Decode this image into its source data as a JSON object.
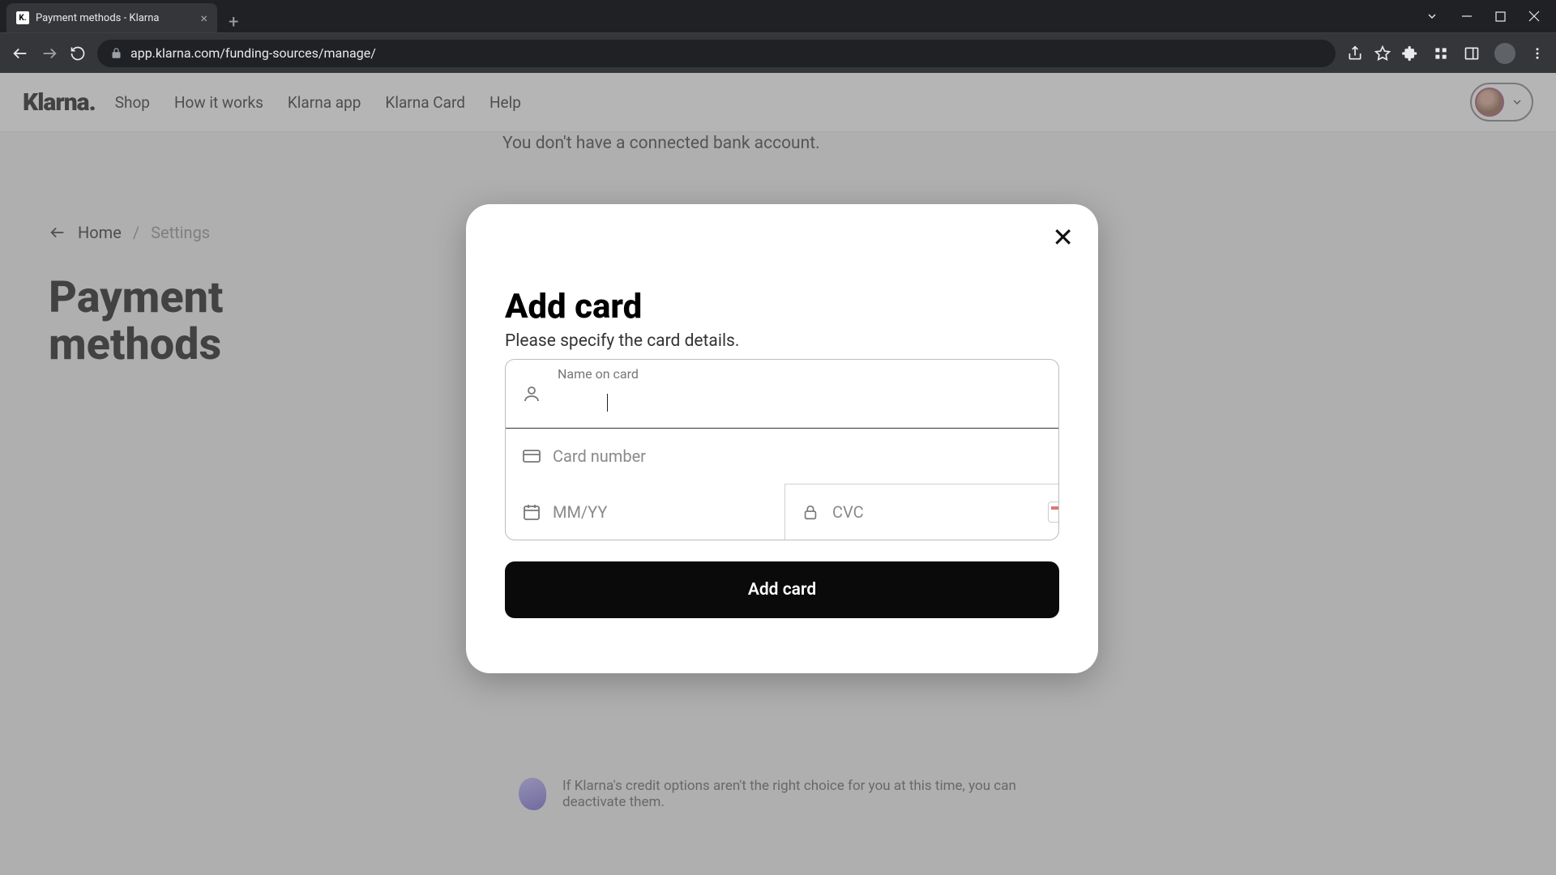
{
  "browser": {
    "tab_title": "Payment methods - Klarna",
    "url": "app.klarna.com/funding-sources/manage/"
  },
  "header": {
    "logo": "Klarna.",
    "nav": [
      "Shop",
      "How it works",
      "Klarna app",
      "Klarna Card",
      "Help"
    ]
  },
  "page": {
    "bank_message": "You don't have a connected bank account.",
    "breadcrumb_home": "Home",
    "breadcrumb_settings": "Settings",
    "title": "Payment methods",
    "credit_snippet": "If Klarna's credit options aren't the right choice for you at this time, you can deactivate them."
  },
  "modal": {
    "title": "Add card",
    "subtitle": "Please specify the card details.",
    "name_label": "Name on card",
    "name_value": "",
    "card_placeholder": "Card number",
    "expiry_placeholder": "MM/YY",
    "cvc_placeholder": "CVC",
    "submit": "Add card"
  }
}
